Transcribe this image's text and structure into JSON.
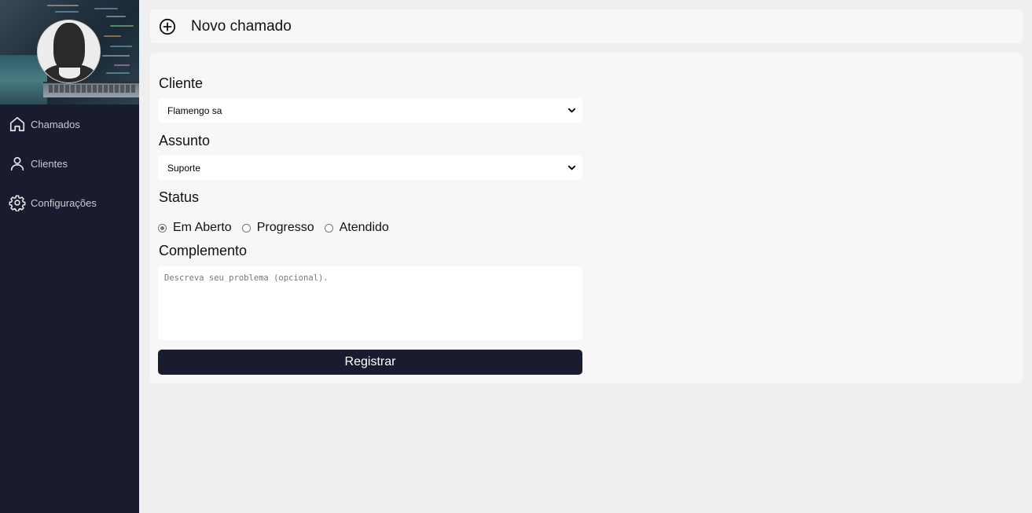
{
  "sidebar": {
    "items": [
      {
        "label": "Chamados",
        "icon": "home-icon"
      },
      {
        "label": "Clientes",
        "icon": "user-icon"
      },
      {
        "label": "Configurações",
        "icon": "gear-icon"
      }
    ]
  },
  "header": {
    "title": "Novo chamado",
    "icon": "plus-circle-icon"
  },
  "form": {
    "cliente_label": "Cliente",
    "cliente_value": "Flamengo sa",
    "assunto_label": "Assunto",
    "assunto_value": "Suporte",
    "status_label": "Status",
    "status_options": [
      {
        "label": "Em Aberto",
        "checked": true
      },
      {
        "label": "Progresso",
        "checked": false
      },
      {
        "label": "Atendido",
        "checked": false
      }
    ],
    "complemento_label": "Complemento",
    "complemento_placeholder": "Descreva seu problema (opcional).",
    "submit_label": "Registrar"
  },
  "colors": {
    "sidebar_bg": "#181c2e",
    "page_bg": "#efefef",
    "card_bg": "#f7f7f7",
    "button_bg": "#181c2e"
  }
}
